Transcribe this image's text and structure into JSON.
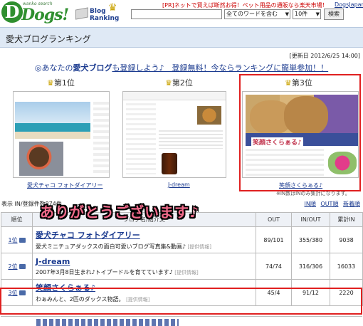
{
  "header": {
    "logo_letter": "D",
    "logo_text": "Dogs!",
    "logo_tagline": "wanko search",
    "blog_ranking": "Blog Ranking",
    "pr_text": "[PR]ネットで買えば断然お得！ペット用品の通販なら楽天市場！",
    "dogs_japan": "DogsJapan",
    "search_value": "",
    "select_mode": "全てのワードを含む",
    "select_count": "10件",
    "search_button": "検索"
  },
  "page": {
    "title": "愛犬ブログランキング",
    "updated": "[更新日 2012/6/25 14:00]",
    "banner_pre": "◎あなたの",
    "banner_mid": "愛犬ブログ",
    "banner_link": "も登録しよう♪　登録無料！今ならランキングに簡単参加！！"
  },
  "top3": [
    {
      "rank_label": "第1位",
      "caption": "愛犬チャコ フォトダイアリー"
    },
    {
      "rank_label": "第2位",
      "caption": "J-dream"
    },
    {
      "rank_label": "第3位",
      "caption": "笑顔さくらぁる♪",
      "thumb_title": "笑顔さくらぁる♪"
    }
  ],
  "note": "※IN数はINのみ集計になります。",
  "list": {
    "count": "表示 IN/登録件数874件",
    "overlay": "ありがとうございます♪",
    "view_links": [
      "IN順",
      "OUT順",
      "新着順"
    ],
    "headers": [
      "順位",
      "ブログ名/紹介文",
      "OUT",
      "IN/OUT",
      "累計IN"
    ],
    "rows": [
      {
        "rank": "1位",
        "name": "愛犬チャコ フォトダイアリー",
        "desc": "愛犬ミニチュアダックスの面白可愛いブログ写真集&動画♪",
        "tag": "[提供情報]",
        "out": "89/101",
        "inout": "355/380",
        "total": "9038"
      },
      {
        "rank": "2位",
        "name": "J-dream",
        "desc": "2007年3月8日生まれ♪トイプードルを育てています♪",
        "tag": "[提供情報]",
        "out": "74/74",
        "inout": "316/306",
        "total": "16033"
      },
      {
        "rank": "3位",
        "name": "笑顔さくらぁる♪",
        "desc": "わぁみんと、2匹のダックス物語。",
        "tag": "[提供情報]",
        "out": "45/4",
        "inout": "91/12",
        "total": "2220"
      }
    ]
  },
  "colors": {
    "link": "#1a3a8f",
    "highlight_border": "#e02020",
    "overlay_text": "#f06a8a",
    "title_bar": "#dfe9f5"
  }
}
